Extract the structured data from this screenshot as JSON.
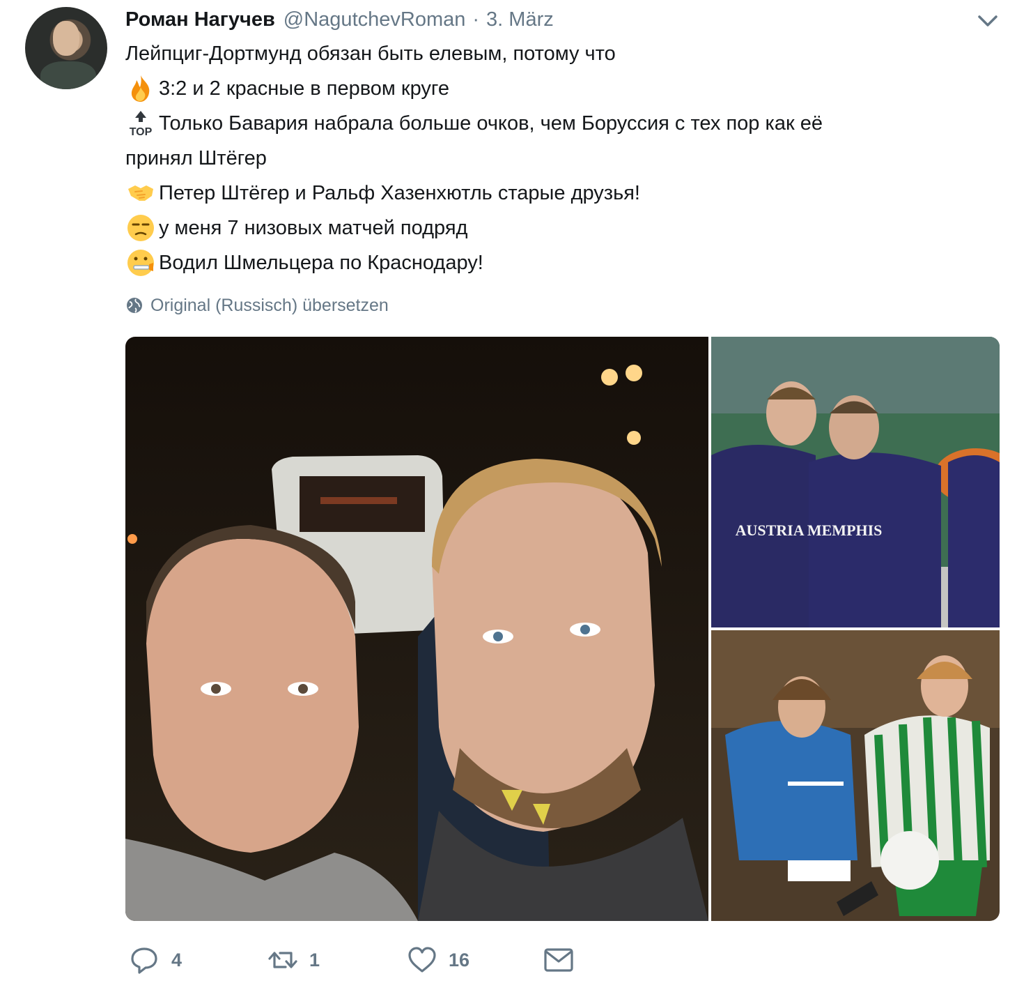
{
  "author": {
    "name": "Роман Нагучев",
    "handle": "@NagutchevRoman",
    "separator": "·",
    "date": "3. März"
  },
  "tweet": {
    "lines": [
      {
        "icon": null,
        "text": "Лейпциг-Дортмунд обязан быть елевым, потому что"
      },
      {
        "icon": "fire-emoji",
        "text": "3:2 и 2 красные в первом круге"
      },
      {
        "icon": "top-arrow-emoji",
        "text": "Только Бавария набрала больше очков, чем Боруссия с тех пор как её"
      },
      {
        "icon": null,
        "text": "принял Штёгер"
      },
      {
        "icon": "handshake-emoji",
        "text": "Петер Штёгер и Ральф Хазенхютль старые друзья!"
      },
      {
        "icon": "unamused-face-emoji",
        "text": "у меня 7 низовых матчей подряд"
      },
      {
        "icon": "zipper-face-emoji",
        "text": "Водил Шмельцера по Краснодару!"
      }
    ],
    "top_icon_label": "TOP"
  },
  "translate": {
    "icon": "globe-icon",
    "label": "Original (Russisch) übersetzen"
  },
  "media": {
    "photos": [
      {
        "name": "selfie-photo"
      },
      {
        "name": "austria-memphis-players-photo",
        "jersey_text": "AUSTRIA MEMPHIS"
      },
      {
        "name": "match-action-photo"
      }
    ]
  },
  "actions": {
    "reply_count": "4",
    "retweet_count": "1",
    "like_count": "16"
  },
  "colors": {
    "text": "#14171a",
    "secondary": "#657786",
    "background": "#ffffff"
  }
}
